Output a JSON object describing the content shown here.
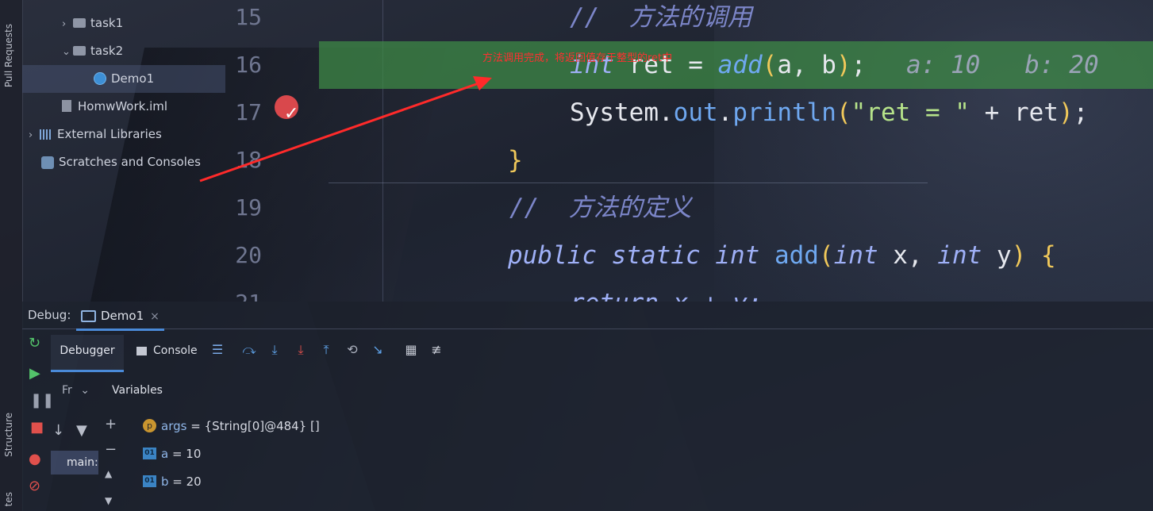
{
  "sidebar_left": {
    "pull_requests_label": "Pull Requests",
    "structure_label": "Structure",
    "bottom_label": "tes"
  },
  "project_tree": {
    "items": [
      {
        "label": "task1"
      },
      {
        "label": "task2"
      },
      {
        "label": "Demo1"
      },
      {
        "label": "HomwWork.iml"
      },
      {
        "label": "External Libraries"
      },
      {
        "label": "Scratches and Consoles"
      }
    ]
  },
  "editor": {
    "lines": [
      {
        "num": "15",
        "text": "//  方法的调用"
      },
      {
        "num": "16",
        "code_a": "int ",
        "code_b": "ret = ",
        "code_fn": "add",
        "code_args": "a, b",
        "code_end": ";",
        "inline_hint": "a: 10   b: 20"
      },
      {
        "num": "17",
        "code_a": "System.",
        "code_fn": "out",
        "code_b": ".",
        "code_fn2": "println",
        "code_str": "\"ret = \"",
        "code_rest": " + ret",
        "code_end": ";"
      },
      {
        "num": "18",
        "text": "}"
      },
      {
        "num": "19",
        "text": "//  方法的定义"
      },
      {
        "num": "20",
        "kw": "public static int ",
        "fn": "add",
        "args_kw1": "int",
        "args_a": " x, ",
        "args_kw2": "int",
        "args_b": " y",
        "end": " {"
      },
      {
        "num": "21",
        "text": "return x + y;"
      }
    ],
    "annotation": "方法调用完成，将返回值存于整型的ret中"
  },
  "debug": {
    "label": "Debug:",
    "session_tab": "Demo1",
    "tabs": {
      "debugger": "Debugger",
      "console": "Console"
    },
    "frames_header": "Fr",
    "variables_header": "Variables",
    "thread": "main:",
    "variables": [
      {
        "icon": "p",
        "name": "args",
        "value": " = {String[0]@484} []"
      },
      {
        "icon": "01",
        "name": "a",
        "value": " = 10"
      },
      {
        "icon": "01",
        "name": "b",
        "value": " = 20"
      }
    ]
  },
  "colors": {
    "highlight_line": "#3e8c46",
    "breakpoint": "#d9484c",
    "annotation": "#ff3030",
    "accent_tab": "#4a8ad8"
  }
}
